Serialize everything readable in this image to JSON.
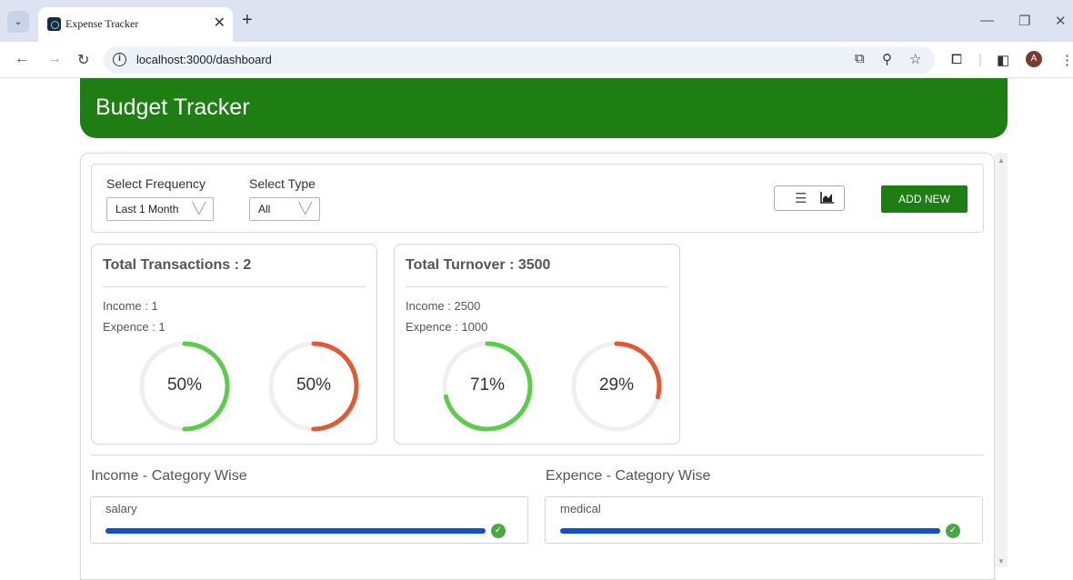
{
  "browser": {
    "tab_title": "Expense Tracker",
    "url": "localhost:3000/dashboard",
    "avatar_letter": "A"
  },
  "app": {
    "title": "Budget Tracker",
    "accent_color": "#1e7e14"
  },
  "filters": {
    "frequency_label": "Select Frequency",
    "frequency_value": "Last 1 Month",
    "type_label": "Select Type",
    "type_value": "All",
    "add_new_label": "ADD NEW"
  },
  "cards": {
    "transactions": {
      "title": "Total Transactions : 2",
      "income_line": "Income : 1",
      "expense_line": "Expence : 1",
      "income_percent": 50,
      "expense_percent": 50,
      "income_label": "50%",
      "expense_label": "50%"
    },
    "turnover": {
      "title": "Total Turnover : 3500",
      "income_line": "Income : 2500",
      "expense_line": "Expence : 1000",
      "income_percent": 71,
      "expense_percent": 29,
      "income_label": "71%",
      "expense_label": "29%"
    },
    "income_color": "#5ccc4a",
    "expense_color": "#e05a33"
  },
  "categories": {
    "income_heading": "Income - Category Wise",
    "expense_heading": "Expence - Category Wise",
    "income_items": [
      {
        "name": "salary",
        "percent": 100
      }
    ],
    "expense_items": [
      {
        "name": "medical",
        "percent": 100
      }
    ],
    "bar_color": "#1251c9"
  }
}
